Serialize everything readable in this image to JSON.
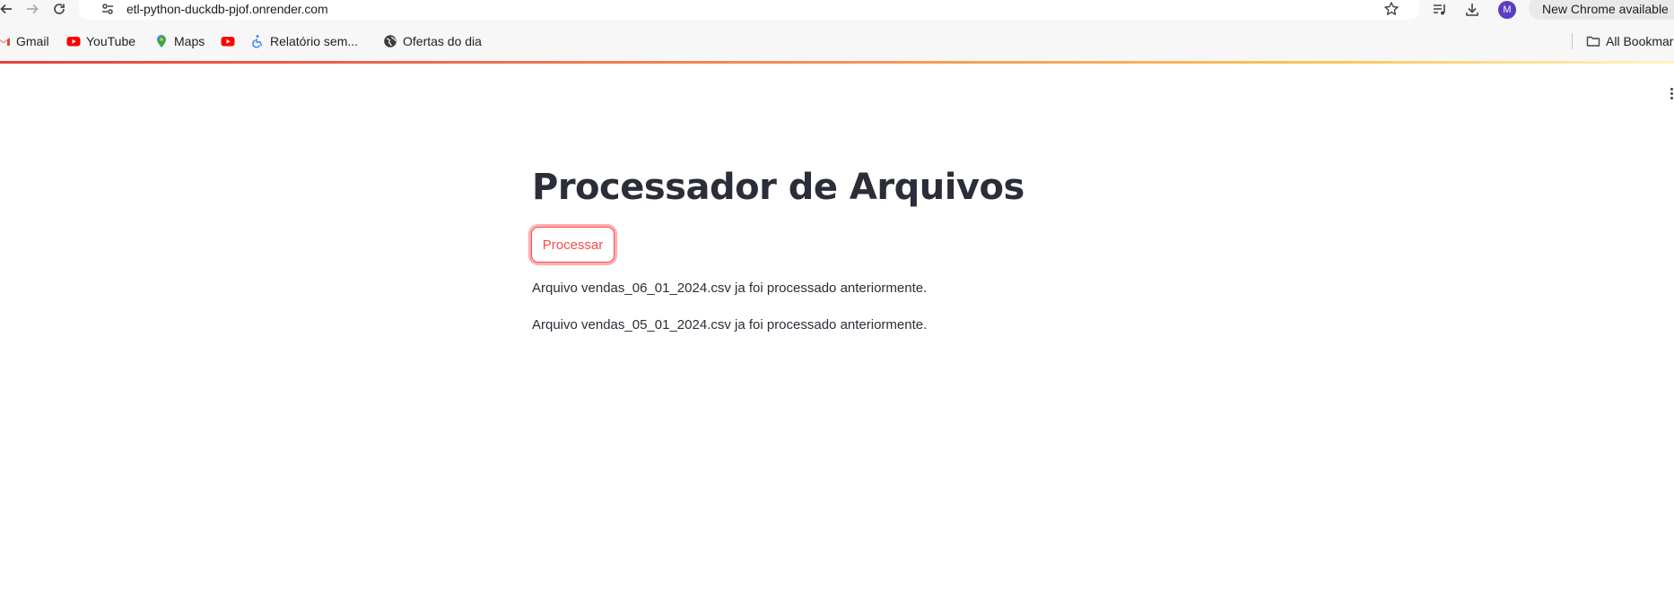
{
  "browser": {
    "url": "etl-python-duckdb-pjof.onrender.com",
    "profile_initial": "M",
    "update_label": "New Chrome available",
    "bookmarks": [
      {
        "label": "Gmail",
        "icon": "gmail-icon"
      },
      {
        "label": "YouTube",
        "icon": "youtube-icon"
      },
      {
        "label": "Maps",
        "icon": "maps-icon"
      },
      {
        "label": "",
        "icon": "youtube-icon"
      },
      {
        "label": "Relatório sem...",
        "icon": "accessibility-icon"
      },
      {
        "label": "Ofertas do dia",
        "icon": "globe-icon"
      }
    ],
    "all_bookmarks_label": "All Bookmarks"
  },
  "page": {
    "title": "Processador de Arquivos",
    "button_label": "Processar",
    "messages": [
      "Arquivo vendas_06_01_2024.csv ja foi processado anteriormente.",
      "Arquivo vendas_05_01_2024.csv ja foi processado anteriormente."
    ]
  },
  "colors": {
    "accent": "#ff4b4b",
    "text": "#2b2d38",
    "avatar": "#5b3cc4"
  }
}
